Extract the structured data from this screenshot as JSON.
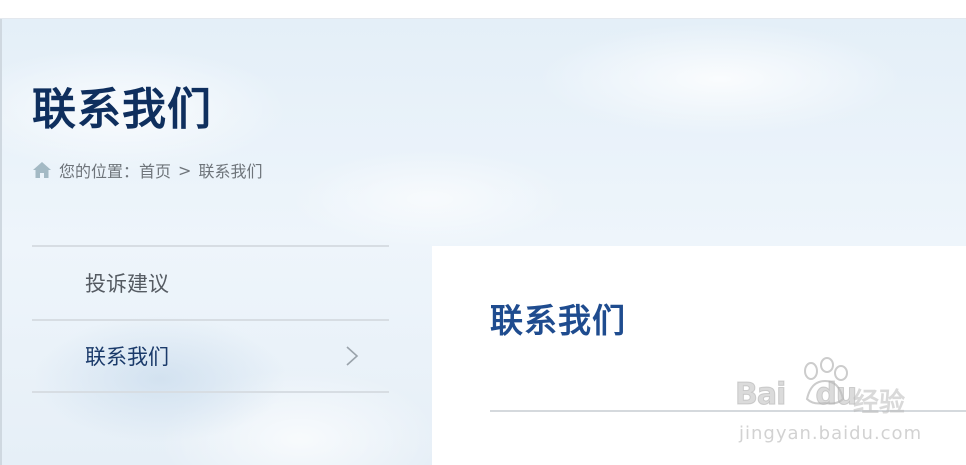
{
  "header": {
    "page_title": "联系我们"
  },
  "breadcrumb": {
    "icon": "home-icon",
    "prefix": "您的位置：",
    "home": "首页",
    "separator": ">",
    "current": "联系我们"
  },
  "sidebar": {
    "items": [
      {
        "label": "投诉建议",
        "active": false
      },
      {
        "label": "联系我们",
        "active": true,
        "icon": "chevron-right-icon"
      }
    ]
  },
  "content": {
    "title": "联系我们"
  },
  "watermark": {
    "brand_left": "Bai",
    "brand_right": "du",
    "product": "经验",
    "url": "jingyan.baidu.com"
  },
  "colors": {
    "title": "#0f2f5e",
    "content_title": "#1f4c8f",
    "active_item": "#1a3a6a",
    "muted_text": "#6e747a"
  }
}
